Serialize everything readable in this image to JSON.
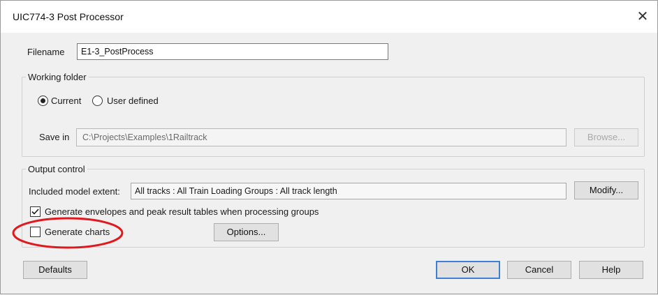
{
  "window": {
    "title": "UIC774-3 Post Processor",
    "close_glyph": "✕"
  },
  "filename": {
    "label": "Filename",
    "value": "E1-3_PostProcess"
  },
  "working_folder": {
    "legend": "Working folder",
    "options": [
      {
        "label": "Current",
        "selected": true
      },
      {
        "label": "User defined",
        "selected": false
      }
    ],
    "save_in_label": "Save in",
    "save_in_value": "C:\\Projects\\Examples\\1Railtrack",
    "browse_label": "Browse..."
  },
  "output_control": {
    "legend": "Output control",
    "extent_label": "Included model extent:",
    "extent_value": "All tracks : All Train Loading Groups : All track length",
    "modify_label": "Modify...",
    "envelopes_label": "Generate envelopes and peak result tables when processing groups",
    "envelopes_checked": true,
    "charts_label": "Generate charts",
    "charts_checked": false,
    "options_label": "Options..."
  },
  "footer": {
    "defaults_label": "Defaults",
    "ok_label": "OK",
    "cancel_label": "Cancel",
    "help_label": "Help"
  },
  "colors": {
    "highlight": "#e0191f",
    "default_button_border": "#3c7fd4"
  }
}
